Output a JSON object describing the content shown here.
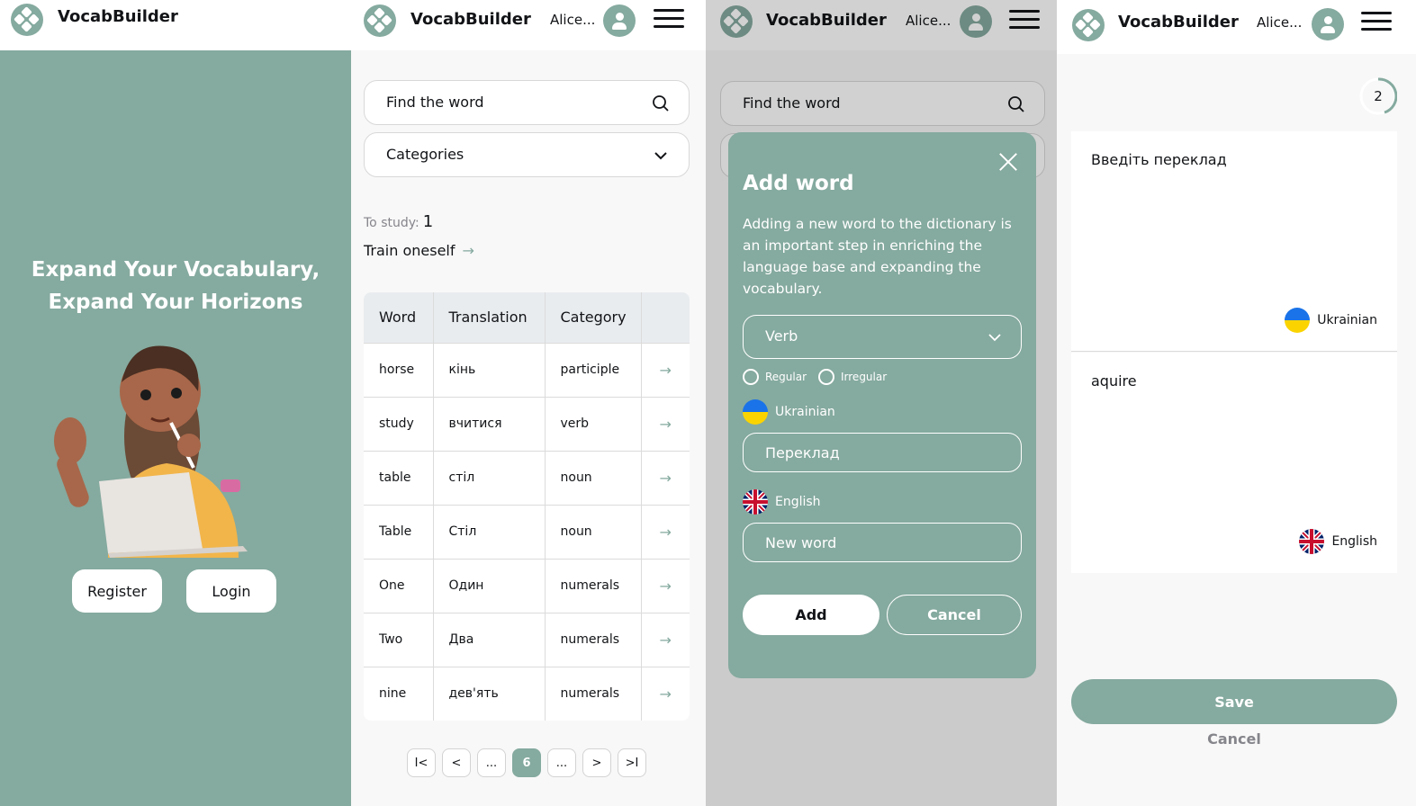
{
  "brand": "VocabBuilder",
  "user": {
    "name": "Alice..."
  },
  "colors": {
    "accent": "#85aa9f",
    "text": "#121417",
    "muted": "#85858c"
  },
  "landing": {
    "title_line1": "Expand Your Vocabulary,",
    "title_line2": "Expand Your Horizons",
    "register_label": "Register",
    "login_label": "Login"
  },
  "dictionary": {
    "search_placeholder": "Find the word",
    "categories_label": "Categories",
    "to_study_label": "To study:",
    "to_study_count": "1",
    "train_label": "Train oneself",
    "columns": [
      "Word",
      "Translation",
      "Category"
    ],
    "rows": [
      {
        "word": "horse",
        "translation": "кінь",
        "category": "participle"
      },
      {
        "word": "study",
        "translation": "вчитися",
        "category": "verb"
      },
      {
        "word": "table",
        "translation": "стіл",
        "category": "noun"
      },
      {
        "word": "Table",
        "translation": "Стіл",
        "category": "noun"
      },
      {
        "word": "One",
        "translation": "Один",
        "category": "numerals"
      },
      {
        "word": "Two",
        "translation": "Два",
        "category": "numerals"
      },
      {
        "word": "nine",
        "translation": "дев'ять",
        "category": "numerals"
      }
    ],
    "pagination": {
      "first": "I<",
      "prev": "<",
      "ellipsis_left": "...",
      "current": "6",
      "ellipsis_right": "...",
      "next": ">",
      "last": ">I"
    }
  },
  "add_word_modal": {
    "title": "Add word",
    "description": "Adding a new word to the dictionary is an important step in enriching the language base and expanding the vocabulary.",
    "category_value": "Verb",
    "radio_regular": "Regular",
    "radio_irregular": "Irregular",
    "lang_ukrainian": "Ukrainian",
    "ukrainian_placeholder": "Переклад",
    "lang_english": "English",
    "english_placeholder": "New word",
    "add_label": "Add",
    "cancel_label": "Cancel"
  },
  "training": {
    "progress_value": "2",
    "translation_placeholder": "Введіть переклад",
    "ukrainian_label": "Ukrainian",
    "english_word": "aquire",
    "english_label": "English",
    "save_label": "Save",
    "cancel_label": "Cancel"
  }
}
